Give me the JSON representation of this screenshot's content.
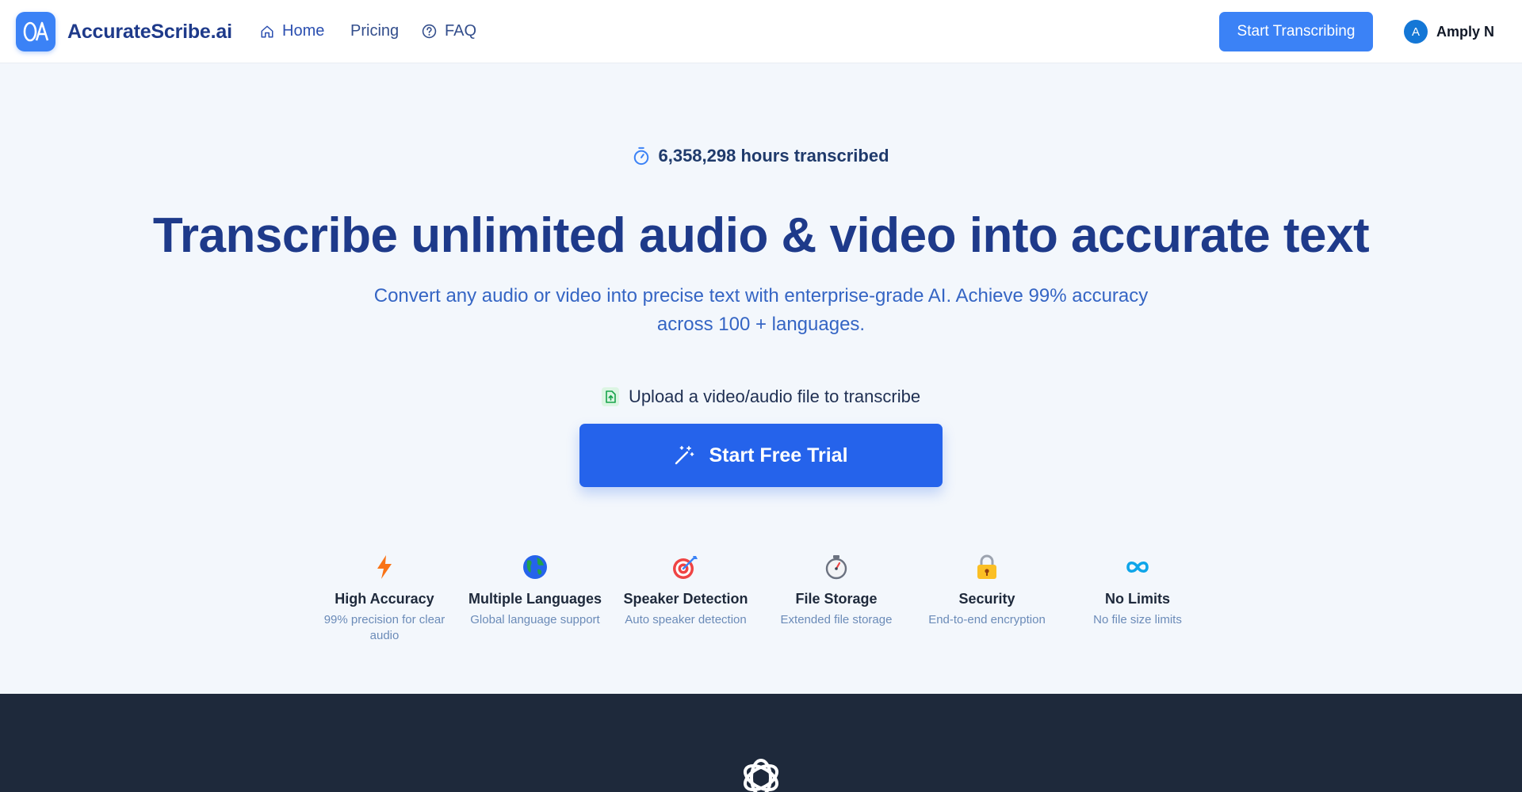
{
  "nav": {
    "brand": "AccurateScribe.ai",
    "logo_text": "OA",
    "links": [
      {
        "label": "Home",
        "icon": "home-icon"
      },
      {
        "label": "Pricing"
      },
      {
        "label": "FAQ",
        "icon": "question-circle-icon"
      }
    ],
    "cta_label": "Start Transcribing",
    "user": {
      "initial": "A",
      "name": "Amply N"
    }
  },
  "hero": {
    "stat_text": "6,358,298 hours transcribed",
    "stat_icon": "stopwatch-icon",
    "headline": "Transcribe unlimited audio & video into accurate text",
    "subhead": "Convert any audio or video into precise text with enterprise-grade AI. Achieve 99% accuracy across 100 + languages.",
    "upload_text": "Upload a video/audio file to transcribe",
    "upload_icon": "file-upload-icon",
    "trial_label": "Start Free Trial",
    "trial_icon": "magic-wand-icon"
  },
  "features": [
    {
      "icon": "lightning-icon",
      "title": "High Accuracy",
      "desc": "99% precision for clear audio"
    },
    {
      "icon": "globe-icon",
      "title": "Multiple Languages",
      "desc": "Global language support"
    },
    {
      "icon": "target-icon",
      "title": "Speaker Detection",
      "desc": "Auto speaker detection"
    },
    {
      "icon": "stopwatch-icon",
      "title": "File Storage",
      "desc": "Extended file storage"
    },
    {
      "icon": "lock-icon",
      "title": "Security",
      "desc": "End-to-end encryption"
    },
    {
      "icon": "infinity-icon",
      "title": "No Limits",
      "desc": "No file size limits"
    }
  ],
  "colors": {
    "brand_blue": "#3b82f6",
    "cta_blue": "#2563eb",
    "headline_navy": "#1e3a8a",
    "footer_bg": "#1e293b",
    "page_bg": "#f3f7fc"
  },
  "footer": {
    "icon": "openai-icon"
  }
}
